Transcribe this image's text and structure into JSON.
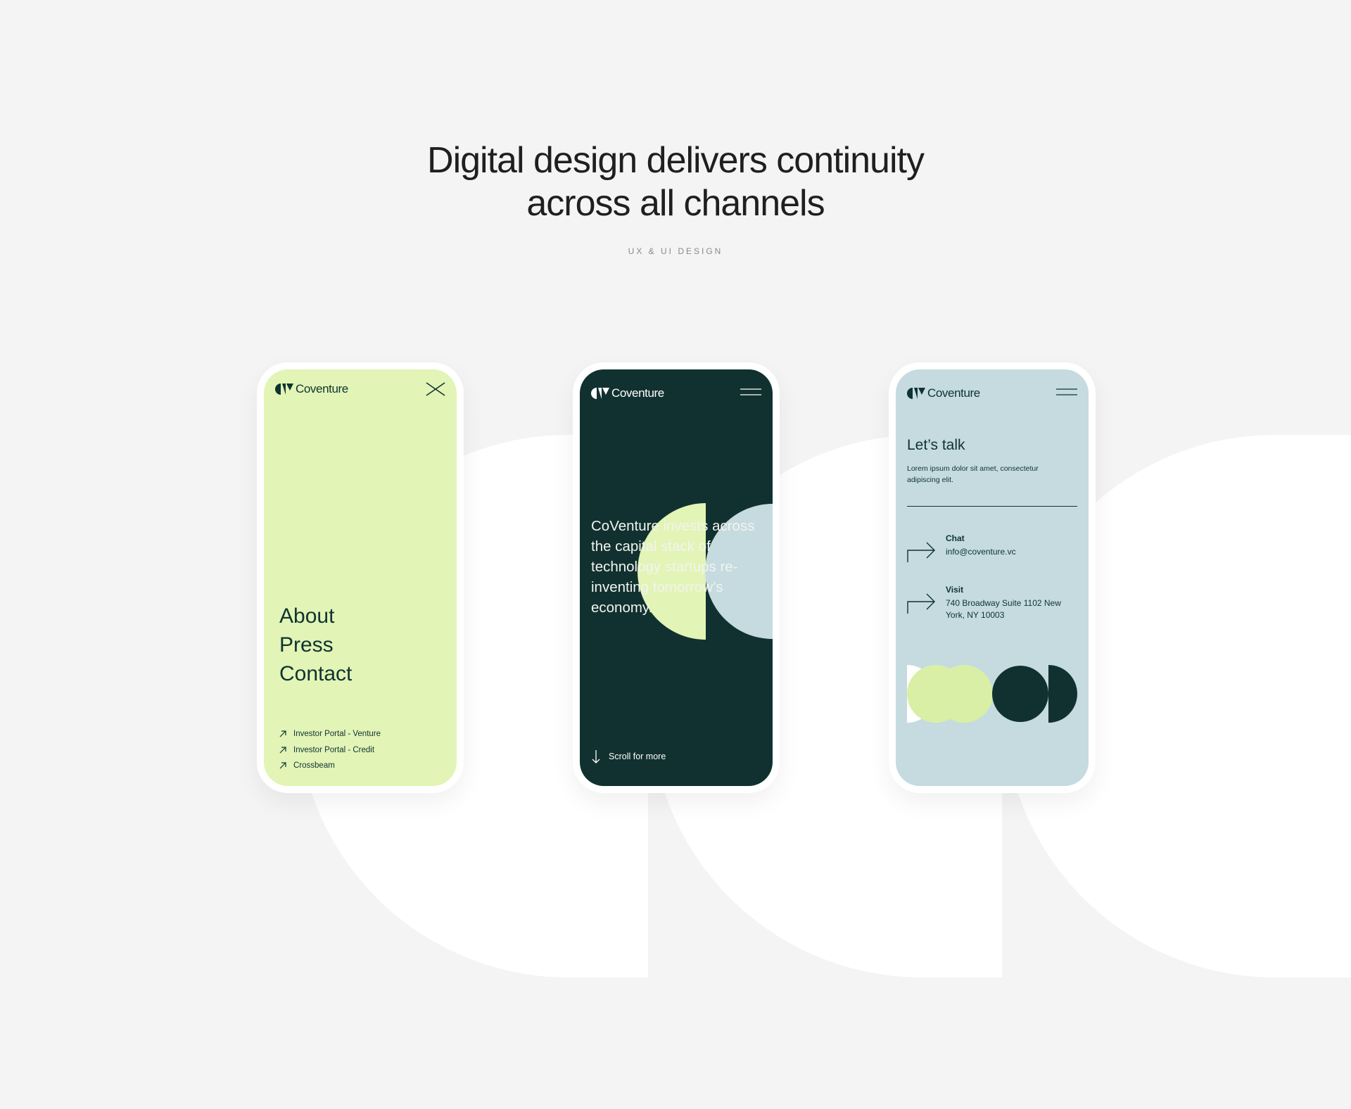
{
  "headline": {
    "line1": "Digital design delivers continuity",
    "line2": "across all channels"
  },
  "subtitle": "UX & UI DESIGN",
  "colors": {
    "background": "#f4f4f4",
    "lime": "#e2f4b6",
    "dark_green": "#113130",
    "light_blue": "#c5dbe0",
    "ink": "#0f3331"
  },
  "phones": {
    "menu": {
      "brand": "Coventure",
      "nav": [
        "About",
        "Press",
        "Contact"
      ],
      "links": [
        "Investor Portal - Venture",
        "Investor Portal - Credit",
        "Crossbeam"
      ]
    },
    "home": {
      "brand": "Coventure",
      "hero": "CoVenture invests across the capital stack of technology startups re-inventing tomorrow’s economy.",
      "scroll": "Scroll for more"
    },
    "contact": {
      "brand": "Coventure",
      "heading": "Let’s talk",
      "intro": "Lorem ipsum dolor sit amet, consectetur adipiscing elit.",
      "chat_label": "Chat",
      "chat_value": "info@coventure.vc",
      "visit_label": "Visit",
      "visit_value": "740 Broadway Suite 1102 New York, NY 10003"
    }
  }
}
